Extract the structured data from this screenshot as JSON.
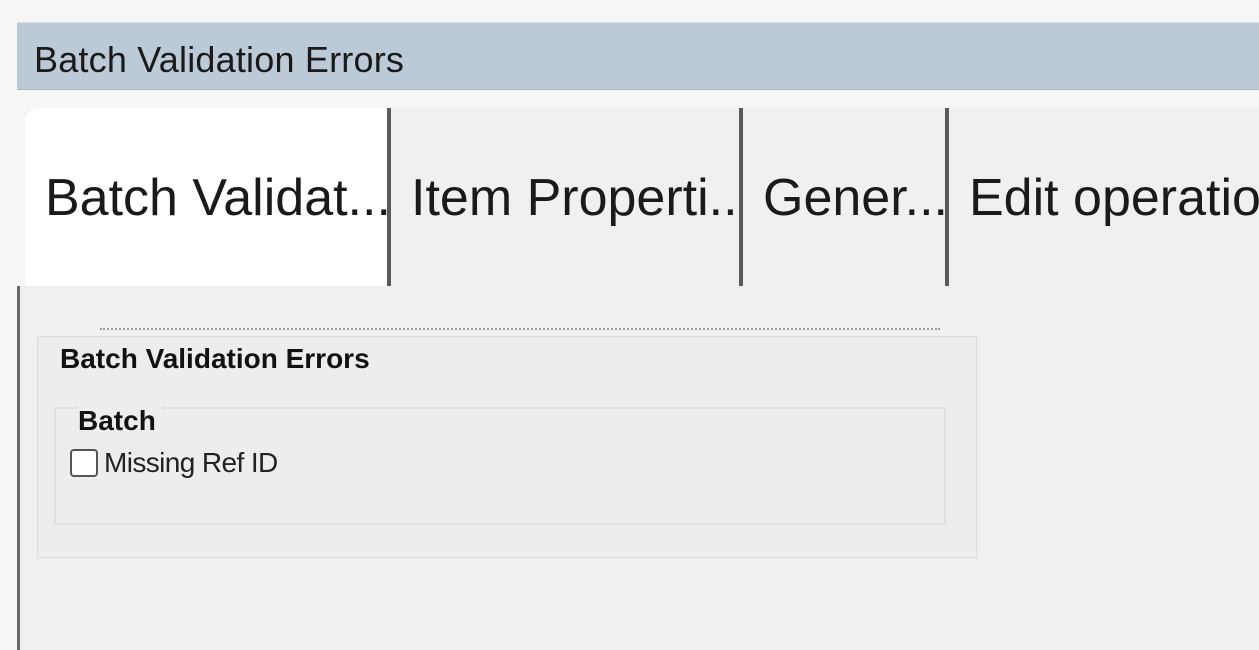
{
  "window": {
    "title": "Batch Validation Errors"
  },
  "tabs": [
    {
      "label": "Batch Validat...",
      "selected": true
    },
    {
      "label": "Item Properti...",
      "selected": false
    },
    {
      "label": "Gener...",
      "selected": false
    },
    {
      "label": "Edit operatio",
      "selected": false
    }
  ],
  "panel": {
    "group_title": "Batch Validation Errors",
    "subgroup_title": "Batch",
    "checkbox": {
      "label": "Missing Ref ID",
      "checked": false
    }
  },
  "colors": {
    "titlebar_bg": "#bccad8",
    "tab_selected_bg": "#ffffff",
    "tab_bg": "#f0f0f0",
    "panel_bg": "#f0f0f0"
  }
}
